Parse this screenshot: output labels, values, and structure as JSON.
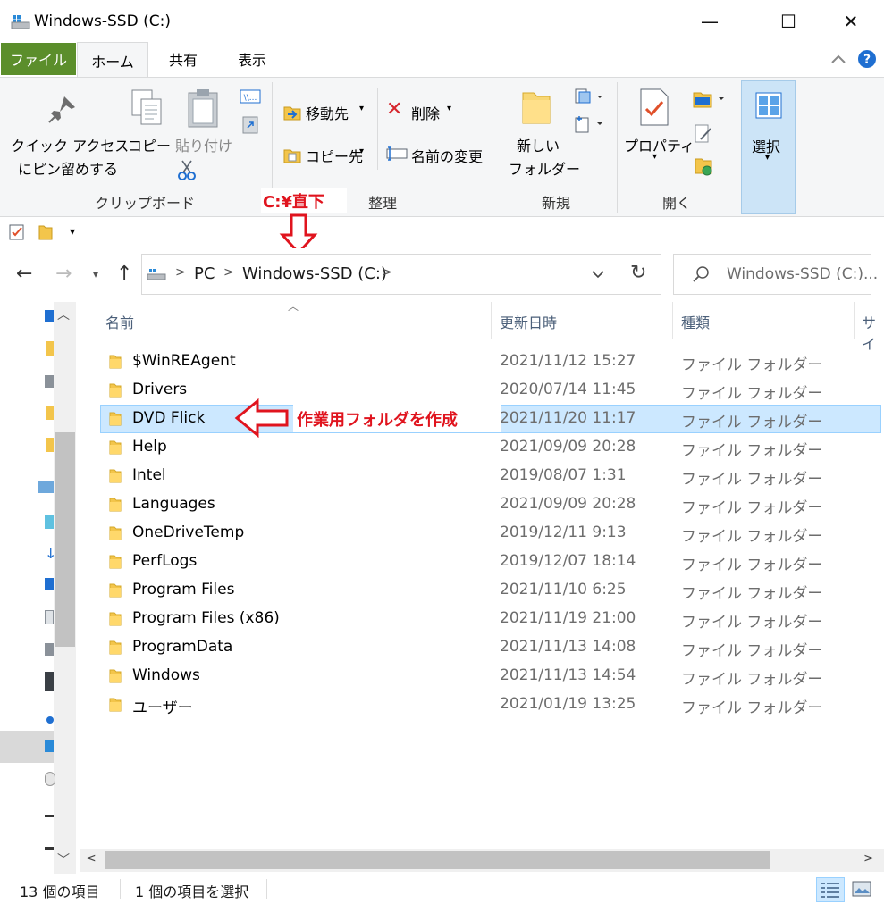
{
  "window": {
    "title": "Windows-SSD (C:)",
    "minimize": "—",
    "maximize": "☐",
    "close": "✕"
  },
  "ribbon_tabs": [
    "ファイル",
    "ホーム",
    "共有",
    "表示"
  ],
  "ribbon": {
    "pin_quick_access_line1": "クイック アクセス",
    "pin_quick_access_line2": "にピン留めする",
    "copy": "コピー",
    "paste": "貼り付け",
    "clipboard_group": "クリップボード",
    "move_to": "移動先",
    "copy_to": "コピー先",
    "delete": "削除",
    "rename": "名前の変更",
    "organize_group": "整理",
    "new_folder_line1": "新しい",
    "new_folder_line2": "フォルダー",
    "new_group": "新規",
    "properties": "プロパティ",
    "open_group": "開く",
    "select": "選択"
  },
  "address": {
    "pc": "PC",
    "drive": "Windows-SSD (C:)",
    "search_placeholder": "Windows-SSD (C:)..."
  },
  "columns": {
    "name": "名前",
    "modified": "更新日時",
    "type": "種類",
    "size": "サイ"
  },
  "files": [
    {
      "name": "$WinREAgent",
      "date": "2021/11/12 15:27",
      "type": "ファイル フォルダー"
    },
    {
      "name": "Drivers",
      "date": "2020/07/14 11:45",
      "type": "ファイル フォルダー"
    },
    {
      "name": "DVD Flick",
      "date": "2021/11/20 11:17",
      "type": "ファイル フォルダー"
    },
    {
      "name": "Help",
      "date": "2021/09/09 20:28",
      "type": "ファイル フォルダー"
    },
    {
      "name": "Intel",
      "date": "2019/08/07 1:31",
      "type": "ファイル フォルダー"
    },
    {
      "name": "Languages",
      "date": "2021/09/09 20:28",
      "type": "ファイル フォルダー"
    },
    {
      "name": "OneDriveTemp",
      "date": "2019/12/11 9:13",
      "type": "ファイル フォルダー"
    },
    {
      "name": "PerfLogs",
      "date": "2019/12/07 18:14",
      "type": "ファイル フォルダー"
    },
    {
      "name": "Program Files",
      "date": "2021/11/10 6:25",
      "type": "ファイル フォルダー"
    },
    {
      "name": "Program Files (x86)",
      "date": "2021/11/19 21:00",
      "type": "ファイル フォルダー"
    },
    {
      "name": "ProgramData",
      "date": "2021/11/13 14:08",
      "type": "ファイル フォルダー"
    },
    {
      "name": "Windows",
      "date": "2021/11/13 14:54",
      "type": "ファイル フォルダー"
    },
    {
      "name": "ユーザー",
      "date": "2021/01/19 13:25",
      "type": "ファイル フォルダー"
    }
  ],
  "status": {
    "item_count": "13 個の項目",
    "selected_count": "1 個の項目を選択"
  },
  "annotations": {
    "root_label": "C:¥直下",
    "create_label": "作業用フォルダを作成"
  },
  "colors": {
    "file_tab": "#5b8e2b",
    "selection": "#cce8ff",
    "annotation": "#e0141e",
    "folder": "#f8d775"
  }
}
